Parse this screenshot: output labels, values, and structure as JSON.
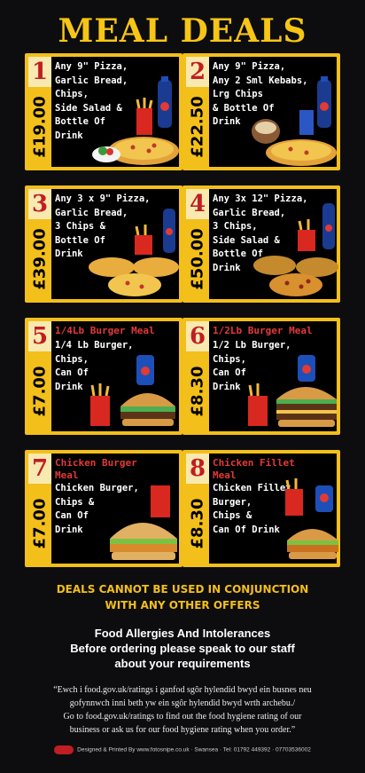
{
  "page": {
    "title": "MEAL DEALS"
  },
  "deals": [
    {
      "number": "1",
      "price": "£19.00",
      "heading": "",
      "description": "Any 9\" Pizza,\nGarlic Bread,\nChips,\nSide Salad &\nBottle Of\nDrink"
    },
    {
      "number": "2",
      "price": "£22.50",
      "heading": "",
      "description": "Any 9\" Pizza,\nAny 2 Sml Kebabs,\nLrg Chips\n& Bottle Of\nDrink"
    },
    {
      "number": "3",
      "price": "£39.00",
      "heading": "",
      "description": "Any 3 x 9\" Pizza,\nGarlic Bread,\n3 Chips &\nBottle Of\nDrink"
    },
    {
      "number": "4",
      "price": "£50.00",
      "heading": "",
      "description": "Any 3x 12\" Pizza,\nGarlic Bread,\n3 Chips,\nSide Salad &\nBottle Of\nDrink"
    },
    {
      "number": "5",
      "price": "£7.00",
      "heading": "1/4Lb Burger Meal",
      "description": "1/4 Lb Burger,\nChips,\nCan Of\nDrink"
    },
    {
      "number": "6",
      "price": "£8.30",
      "heading": "1/2Lb Burger Meal",
      "description": "1/2 Lb Burger,\nChips,\nCan Of\nDrink"
    },
    {
      "number": "7",
      "price": "£7.00",
      "heading": "Chicken Burger\nMeal",
      "description": "Chicken Burger,\nChips &\nCan Of\nDrink"
    },
    {
      "number": "8",
      "price": "£8.30",
      "heading": "Chicken Fillet\nMeal",
      "description": "Chicken Fillet\nBurger,\nChips &\nCan Of Drink"
    }
  ],
  "notice": {
    "line1": "DEALS CANNOT BE USED IN CONJUNCTION",
    "line2": "WITH ANY OTHER OFFERS"
  },
  "allergy": {
    "line1": "Food Allergies And Intolerances",
    "line2": "Before ordering please speak to our staff",
    "line3": "about your requirements"
  },
  "hygiene": {
    "line1": "“Ewch i food.gov.uk/ratings i ganfod sgôr hylendid bwyd ein busnes neu",
    "line2": "gofynnwch inni beth yw ein sgôr hylendid bwyd wrth archebu./",
    "line3": "Go to food.gov.uk/ratings to find out the food hygiene rating of our",
    "line4": "business or ask us for our food hygiene rating when you order.”"
  },
  "footer": {
    "text": "Designed & Printed By www.fotosnipe.co.uk · Swansea · Tel: 01792 449392 · 07703536002"
  },
  "colors": {
    "accent": "#f3bf1a",
    "number_red": "#c01e22",
    "background": "#0d0d0f"
  }
}
